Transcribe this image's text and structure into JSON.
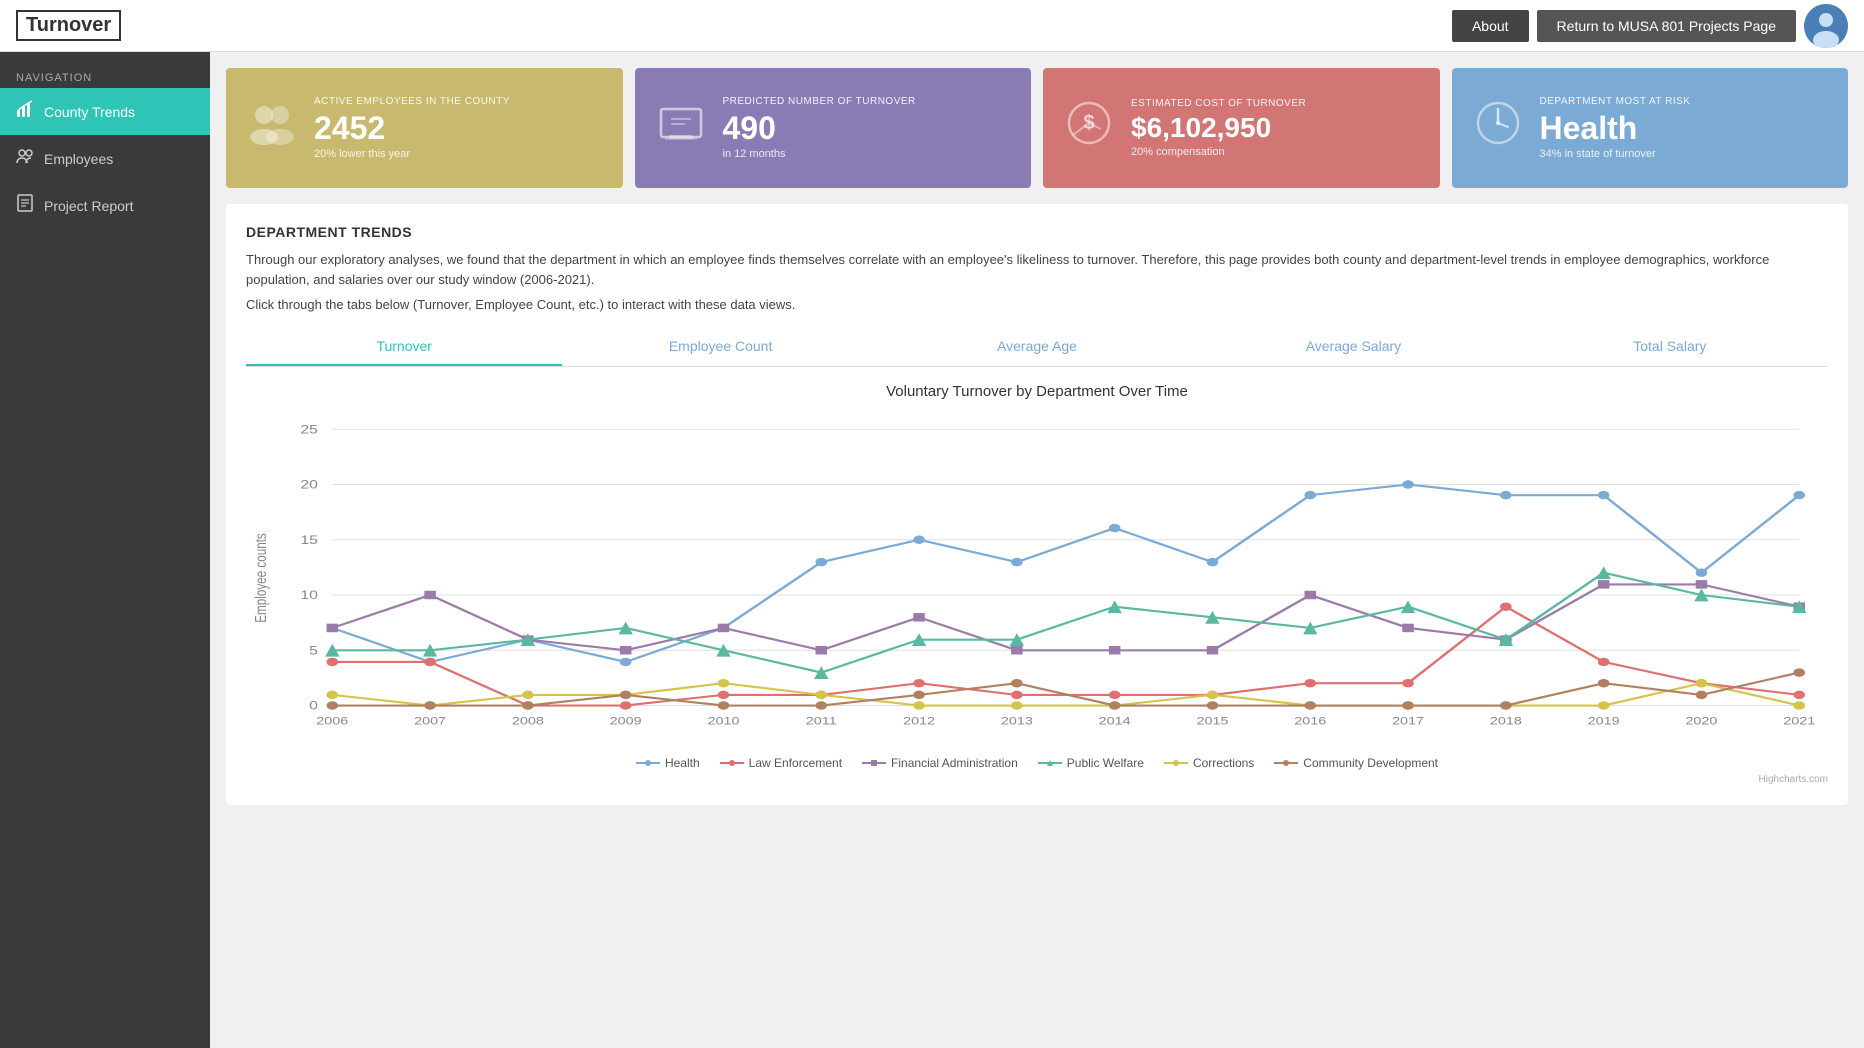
{
  "header": {
    "logo": "Turnover",
    "buttons": {
      "about": "About",
      "return": "Return to MUSA 801 Projects Page"
    }
  },
  "sidebar": {
    "nav_label": "NAVIGATION",
    "items": [
      {
        "id": "county-trends",
        "label": "County Trends",
        "icon": "📊",
        "active": true
      },
      {
        "id": "employees",
        "label": "Employees",
        "icon": "👥",
        "active": false
      },
      {
        "id": "project-report",
        "label": "Project Report",
        "icon": "📋",
        "active": false
      }
    ]
  },
  "cards": [
    {
      "id": "active-employees",
      "color": "card-yellow",
      "label": "ACTIVE EMPLOYEES IN THE COUNTY",
      "value": "2452",
      "sub": "20% lower this year",
      "icon": "👥"
    },
    {
      "id": "predicted-turnover",
      "color": "card-purple",
      "label": "PREDICTED NUMBER OF TURNOVER",
      "value": "490",
      "sub": "in 12 months",
      "icon": "🖥️"
    },
    {
      "id": "estimated-cost",
      "color": "card-red",
      "label": "ESTIMATED COST OF TURNOVER",
      "value": "$6,102,950",
      "sub": "20% compensation",
      "icon": "💰"
    },
    {
      "id": "dept-at-risk",
      "color": "card-blue",
      "label": "DEPARTMENT MOST AT RISK",
      "value": "Health",
      "sub": "34% in state of turnover",
      "icon": "🕐"
    }
  ],
  "trends": {
    "section_title": "DEPARTMENT TRENDS",
    "description": "Through our exploratory analyses, we found that the department in which an employee finds themselves correlate with an employee's likeliness to turnover. Therefore, this page provides both county and department-level trends in employee demographics, workforce population, and salaries over our study window (2006-2021).",
    "instruction": "Click through the tabs below (Turnover, Employee Count, etc.) to interact with these data views.",
    "tabs": [
      {
        "id": "turnover",
        "label": "Turnover",
        "active": true
      },
      {
        "id": "employee-count",
        "label": "Employee Count",
        "active": false
      },
      {
        "id": "average-age",
        "label": "Average Age",
        "active": false
      },
      {
        "id": "average-salary",
        "label": "Average Salary",
        "active": false
      },
      {
        "id": "total-salary",
        "label": "Total Salary",
        "active": false
      }
    ],
    "chart_title": "Voluntary Turnover by Department Over Time",
    "y_axis_label": "Employee counts",
    "y_max": 25,
    "x_years": [
      "2006",
      "2007",
      "2008",
      "2009",
      "2010",
      "2011",
      "2012",
      "2013",
      "2014",
      "2015",
      "2016",
      "2017",
      "2018",
      "2019",
      "2020",
      "2021"
    ],
    "series": [
      {
        "name": "Health",
        "color": "#7baad4",
        "data": [
          7,
          4,
          6,
          4,
          7,
          13,
          15,
          13,
          16,
          13,
          19,
          20,
          19,
          19,
          12,
          19
        ]
      },
      {
        "name": "Law Enforcement",
        "color": "#e07070",
        "data": [
          4,
          4,
          0,
          0,
          1,
          1,
          2,
          1,
          1,
          1,
          2,
          2,
          9,
          4,
          2,
          1
        ]
      },
      {
        "name": "Financial Administration",
        "color": "#9b7baa",
        "data": [
          7,
          10,
          6,
          5,
          7,
          5,
          8,
          5,
          5,
          5,
          10,
          7,
          6,
          12,
          12,
          9
        ]
      },
      {
        "name": "Public Welfare",
        "color": "#5bb8a0",
        "data": [
          5,
          5,
          6,
          7,
          5,
          3,
          6,
          6,
          9,
          8,
          7,
          9,
          6,
          11,
          10,
          9
        ]
      },
      {
        "name": "Corrections",
        "color": "#d4c44a",
        "data": [
          1,
          0,
          1,
          1,
          2,
          1,
          0,
          0,
          0,
          1,
          0,
          0,
          0,
          0,
          2,
          0
        ]
      },
      {
        "name": "Community Development",
        "color": "#b08060",
        "data": [
          0,
          0,
          0,
          1,
          0,
          0,
          1,
          2,
          0,
          0,
          0,
          0,
          0,
          2,
          1,
          3
        ]
      }
    ],
    "legend": [
      {
        "name": "Health",
        "color": "#7baad4"
      },
      {
        "name": "Law Enforcement",
        "color": "#e07070"
      },
      {
        "name": "Financial Administration",
        "color": "#9b7baa"
      },
      {
        "name": "Public Welfare",
        "color": "#5bb8a0"
      },
      {
        "name": "Corrections",
        "color": "#d4c44a"
      },
      {
        "name": "Community Development",
        "color": "#b08060"
      }
    ],
    "highcharts_credit": "Highcharts.com"
  }
}
